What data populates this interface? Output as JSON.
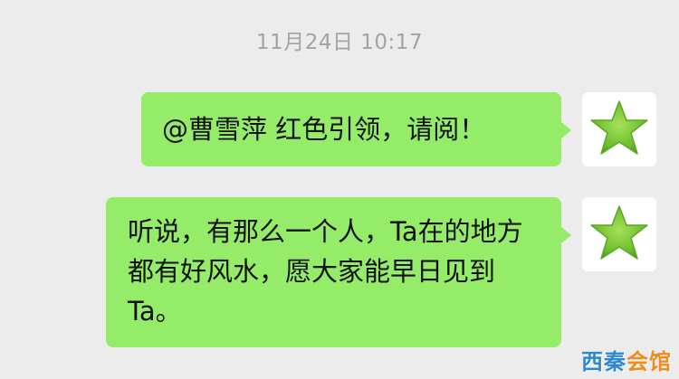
{
  "chat": {
    "timestamp": "11月24日 10:17",
    "messages": [
      {
        "sender": "self",
        "avatar_icon": "green-star-icon",
        "text": "@曹雪萍 红色引领，请阅！"
      },
      {
        "sender": "self",
        "avatar_icon": "green-star-icon",
        "text": "听说，有那么一个人，Ta在的地方都有好风水，愿大家能早日见到Ta。"
      }
    ]
  },
  "watermark": {
    "part1": "西秦",
    "part2": "会馆"
  },
  "colors": {
    "background": "#ececec",
    "bubble": "#95ec69",
    "timestamp": "#a3a3a3",
    "star": "#6fbf2e",
    "watermark_blue": "#2e88d0",
    "watermark_orange": "#f08a1c"
  }
}
